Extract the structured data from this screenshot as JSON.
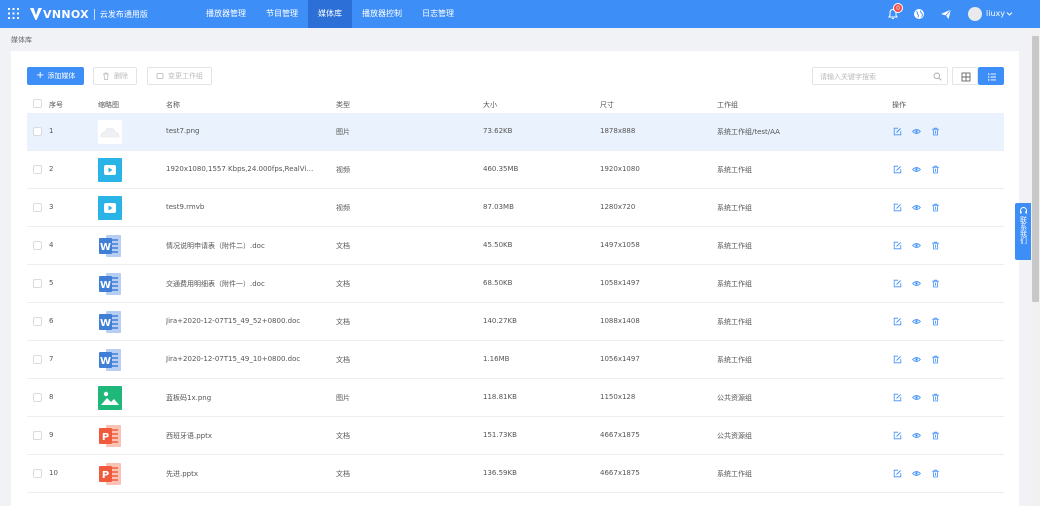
{
  "app": {
    "logo_text": "VNNOX",
    "subtitle": "云发布通用版"
  },
  "nav": [
    "播放器管理",
    "节目管理",
    "媒体库",
    "播放器控制",
    "日志管理"
  ],
  "nav_active": 2,
  "header": {
    "notification_count": "0",
    "username": "liuxy"
  },
  "breadcrumb": "媒体库",
  "toolbar": {
    "add_label": "添加媒体",
    "delete_label": "删除",
    "change_group_label": "变更工作组",
    "search_placeholder": "请输入关键字搜索"
  },
  "table": {
    "columns": [
      "序号",
      "缩略图",
      "名称",
      "类型",
      "大小",
      "尺寸",
      "工作组",
      "操作"
    ],
    "rows": [
      {
        "no": "1",
        "name": "test7.png",
        "type": "图片",
        "size": "73.62KB",
        "dim": "1878x888",
        "group": "系统工作组/test/AA",
        "thumb": "cloud",
        "selected": true
      },
      {
        "no": "2",
        "name": "1920x1080,1557 Kbps,24.000fps,RealVideo 4,...",
        "type": "视频",
        "size": "460.35MB",
        "dim": "1920x1080",
        "group": "系统工作组",
        "thumb": "video"
      },
      {
        "no": "3",
        "name": "test9.rmvb",
        "type": "视频",
        "size": "87.03MB",
        "dim": "1280x720",
        "group": "系统工作组",
        "thumb": "video"
      },
      {
        "no": "4",
        "name": "情况说明申请表（附件二）.doc",
        "type": "文档",
        "size": "45.50KB",
        "dim": "1497x1058",
        "group": "系统工作组",
        "thumb": "word"
      },
      {
        "no": "5",
        "name": "交通费用明细表（附件一）.doc",
        "type": "文档",
        "size": "68.50KB",
        "dim": "1058x1497",
        "group": "系统工作组",
        "thumb": "word"
      },
      {
        "no": "6",
        "name": "Jira+2020-12-07T15_49_52+0800.doc",
        "type": "文档",
        "size": "140.27KB",
        "dim": "1088x1408",
        "group": "系统工作组",
        "thumb": "word"
      },
      {
        "no": "7",
        "name": "Jira+2020-12-07T15_49_10+0800.doc",
        "type": "文档",
        "size": "1.16MB",
        "dim": "1056x1497",
        "group": "系统工作组",
        "thumb": "word"
      },
      {
        "no": "8",
        "name": "蓝板码1x.png",
        "type": "图片",
        "size": "118.81KB",
        "dim": "1150x128",
        "group": "公共资源组",
        "thumb": "image"
      },
      {
        "no": "9",
        "name": "西班牙语.pptx",
        "type": "文档",
        "size": "151.73KB",
        "dim": "4667x1875",
        "group": "公共资源组",
        "thumb": "ppt"
      },
      {
        "no": "10",
        "name": "先进.pptx",
        "type": "文档",
        "size": "136.59KB",
        "dim": "4667x1875",
        "group": "系统工作组",
        "thumb": "ppt"
      }
    ]
  },
  "contact_label": "联系我们",
  "colors": {
    "primary": "#3e8ef7",
    "video": "#2ab3e6",
    "word": "#3f7fd6",
    "image": "#1fb87a",
    "ppt": "#f05a3c"
  }
}
